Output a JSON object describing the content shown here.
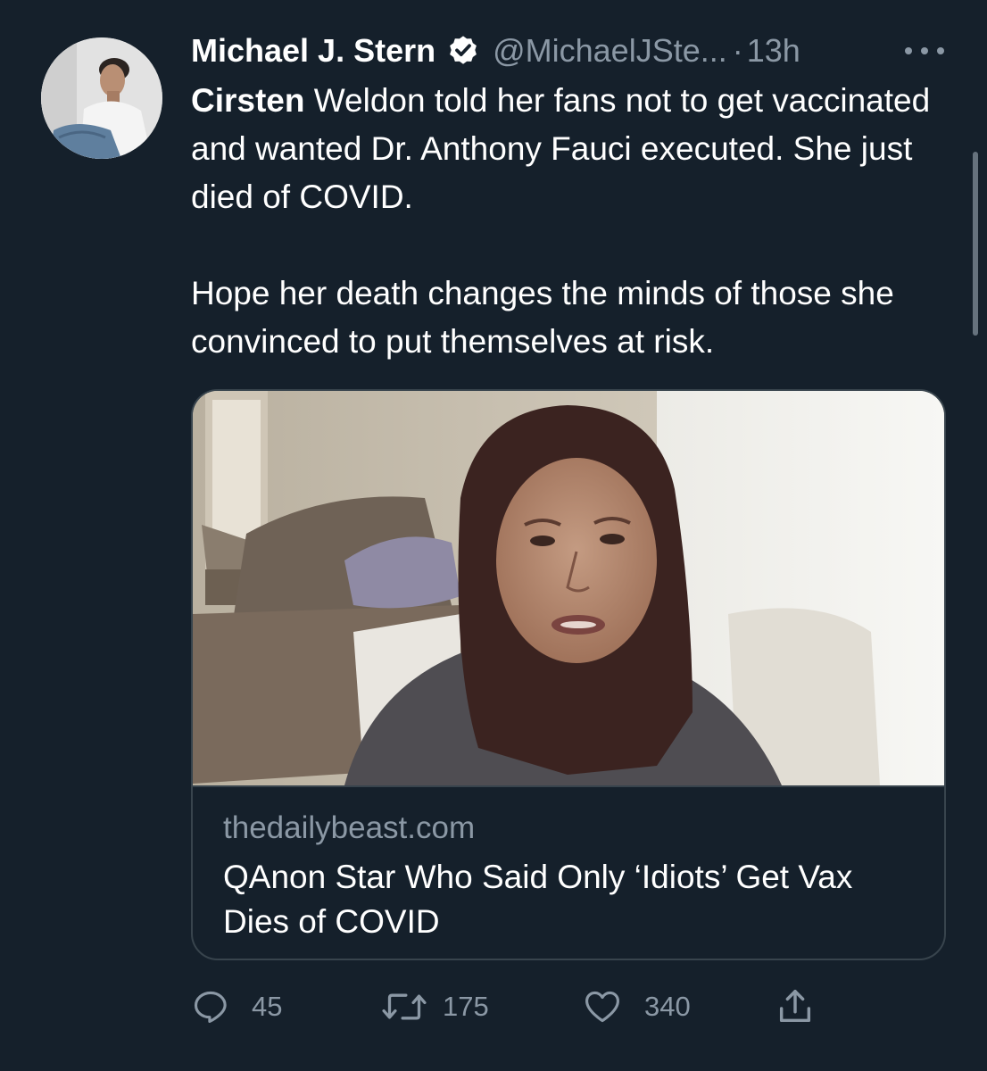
{
  "tweet": {
    "author": {
      "name": "Michael J. Stern",
      "handle": "@MichaelJSte...",
      "verified": true
    },
    "separator": "·",
    "time": "13h",
    "text": {
      "line1_bold": "Cirsten",
      "line1_rest": " Weldon told her fans not to get vaccinated and wanted Dr. Anthony Fauci executed.  She just died of COVID.",
      "paragraph2": "Hope her death changes the minds of those she convinced to put themselves at risk."
    },
    "card": {
      "domain": "thedailybeast.com",
      "title": "QAnon Star Who Said Only ‘Idiots’ Get Vax Dies of COVID"
    },
    "actions": {
      "replies": "45",
      "retweets": "175",
      "likes": "340"
    }
  },
  "icons": {
    "verified": "verified-badge-icon",
    "more": "more-icon",
    "reply": "reply-icon",
    "retweet": "retweet-icon",
    "like": "heart-icon",
    "share": "share-icon"
  },
  "colors": {
    "background": "#15202b",
    "text": "#ffffff",
    "secondary": "#8b98a5",
    "border": "#38444d"
  }
}
